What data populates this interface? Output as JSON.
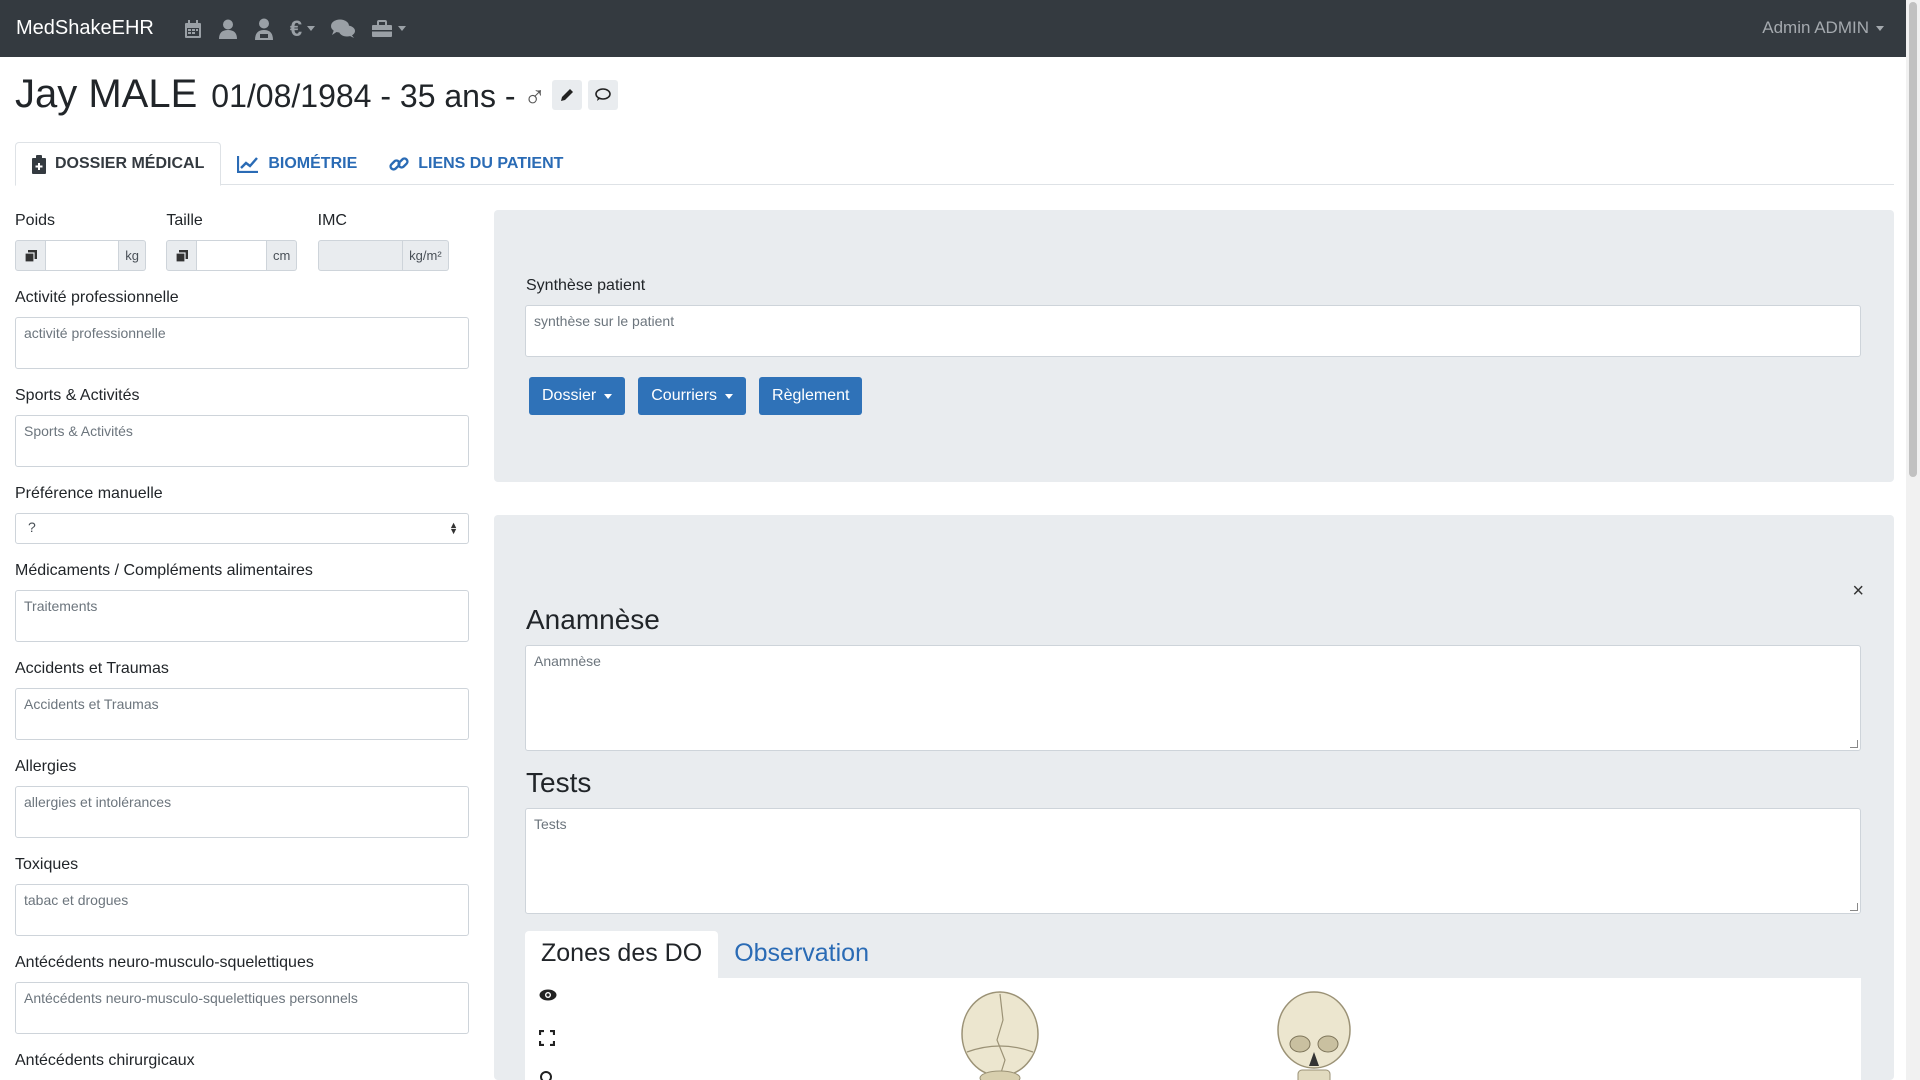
{
  "navbar": {
    "brand": "MedShakeEHR",
    "icons": [
      "calendar-icon",
      "user-icon",
      "user-doctor-icon",
      "euro-icon",
      "comments-icon",
      "toolbox-icon"
    ],
    "euro_symbol": "€",
    "user_menu": "Admin ADMIN"
  },
  "patient": {
    "name": "Jay MALE",
    "meta": "01/08/1984 - 35 ans -",
    "sex_symbol": "♂"
  },
  "tabs": [
    {
      "label": "DOSSIER MÉDICAL",
      "icon": "file-medical-icon",
      "active": true
    },
    {
      "label": "BIOMÉTRIE",
      "icon": "chart-line-icon",
      "active": false
    },
    {
      "label": "LIENS DU PATIENT",
      "icon": "link-icon",
      "active": false
    }
  ],
  "biometrics": {
    "poids_label": "Poids",
    "poids_unit": "kg",
    "taille_label": "Taille",
    "taille_unit": "cm",
    "imc_label": "IMC",
    "imc_unit": "kg/m²"
  },
  "left_fields": [
    {
      "label": "Activité professionnelle",
      "placeholder": "activité professionnelle"
    },
    {
      "label": "Sports & Activités",
      "placeholder": "Sports & Activités"
    },
    {
      "label": "Préférence manuelle",
      "select_value": "?"
    },
    {
      "label": "Médicaments / Compléments alimentaires",
      "placeholder": "Traitements"
    },
    {
      "label": "Accidents et Traumas",
      "placeholder": "Accidents et Traumas"
    },
    {
      "label": "Allergies",
      "placeholder": "allergies et intolérances"
    },
    {
      "label": "Toxiques",
      "placeholder": "tabac et drogues"
    },
    {
      "label": "Antécédents neuro-musculo-squelettiques",
      "placeholder": "Antécédents neuro-musculo-squelettiques personnels"
    },
    {
      "label": "Antécédents chirurgicaux"
    }
  ],
  "synthese": {
    "label": "Synthèse patient",
    "placeholder": "synthèse sur le patient",
    "buttons": [
      "Dossier",
      "Courriers",
      "Règlement"
    ]
  },
  "consult": {
    "close_symbol": "×",
    "anamnese_title": "Anamnèse",
    "anamnese_placeholder": "Anamnèse",
    "tests_title": "Tests",
    "tests_placeholder": "Tests",
    "subtabs": [
      "Zones des DO",
      "Observation"
    ]
  },
  "colors": {
    "navbar": "#343a40",
    "link": "#2a6bb5",
    "button": "#2f72b8",
    "panel": "#e9ecef"
  }
}
